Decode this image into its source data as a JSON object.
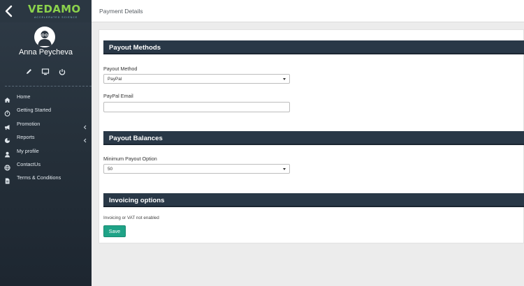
{
  "app": {
    "logo_text": "VEDAMO",
    "logo_tagline": "ACCELERATED SCIENCE"
  },
  "user": {
    "name": "Anna Peycheva"
  },
  "sidebar": {
    "items": [
      {
        "label": "Home",
        "icon": "home-icon"
      },
      {
        "label": "Getting Started",
        "icon": "stopwatch-icon"
      },
      {
        "label": "Promotion",
        "icon": "megaphone-icon",
        "has_submenu": true
      },
      {
        "label": "Reports",
        "icon": "chart-icon",
        "has_submenu": true
      },
      {
        "label": "My profile",
        "icon": "user-icon"
      },
      {
        "label": "ContactUs",
        "icon": "globe-icon"
      },
      {
        "label": "Terms & Conditions",
        "icon": "document-icon"
      }
    ]
  },
  "header": {
    "title": "Payment Details"
  },
  "payout_methods": {
    "heading": "Payout Methods",
    "method_label": "Payout Method",
    "method_value": "PayPal",
    "email_label": "PayPal Email",
    "email_value": ""
  },
  "payout_balances": {
    "heading": "Payout Balances",
    "minimum_label": "Minimum Payout Option",
    "minimum_value": "50"
  },
  "invoicing": {
    "heading": "Invoicing options",
    "note": "Invoicing or VAT not enabled",
    "save_label": "Save"
  },
  "colors": {
    "sidebar": "#26313b",
    "section_header": "#293847",
    "save_button": "#1fa387",
    "logo_green": "#8bd24c"
  }
}
